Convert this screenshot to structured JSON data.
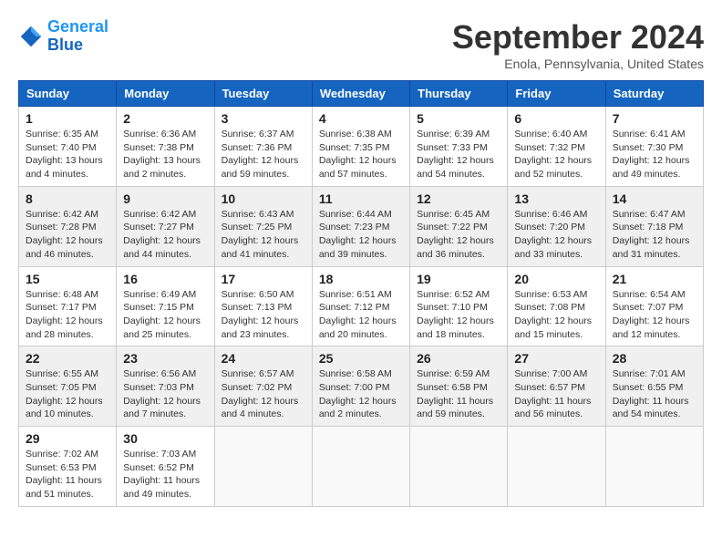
{
  "header": {
    "logo_line1": "General",
    "logo_line2": "Blue",
    "month": "September 2024",
    "location": "Enola, Pennsylvania, United States"
  },
  "weekdays": [
    "Sunday",
    "Monday",
    "Tuesday",
    "Wednesday",
    "Thursday",
    "Friday",
    "Saturday"
  ],
  "weeks": [
    [
      {
        "day": "1",
        "info": "Sunrise: 6:35 AM\nSunset: 7:40 PM\nDaylight: 13 hours\nand 4 minutes."
      },
      {
        "day": "2",
        "info": "Sunrise: 6:36 AM\nSunset: 7:38 PM\nDaylight: 13 hours\nand 2 minutes."
      },
      {
        "day": "3",
        "info": "Sunrise: 6:37 AM\nSunset: 7:36 PM\nDaylight: 12 hours\nand 59 minutes."
      },
      {
        "day": "4",
        "info": "Sunrise: 6:38 AM\nSunset: 7:35 PM\nDaylight: 12 hours\nand 57 minutes."
      },
      {
        "day": "5",
        "info": "Sunrise: 6:39 AM\nSunset: 7:33 PM\nDaylight: 12 hours\nand 54 minutes."
      },
      {
        "day": "6",
        "info": "Sunrise: 6:40 AM\nSunset: 7:32 PM\nDaylight: 12 hours\nand 52 minutes."
      },
      {
        "day": "7",
        "info": "Sunrise: 6:41 AM\nSunset: 7:30 PM\nDaylight: 12 hours\nand 49 minutes."
      }
    ],
    [
      {
        "day": "8",
        "info": "Sunrise: 6:42 AM\nSunset: 7:28 PM\nDaylight: 12 hours\nand 46 minutes."
      },
      {
        "day": "9",
        "info": "Sunrise: 6:42 AM\nSunset: 7:27 PM\nDaylight: 12 hours\nand 44 minutes."
      },
      {
        "day": "10",
        "info": "Sunrise: 6:43 AM\nSunset: 7:25 PM\nDaylight: 12 hours\nand 41 minutes."
      },
      {
        "day": "11",
        "info": "Sunrise: 6:44 AM\nSunset: 7:23 PM\nDaylight: 12 hours\nand 39 minutes."
      },
      {
        "day": "12",
        "info": "Sunrise: 6:45 AM\nSunset: 7:22 PM\nDaylight: 12 hours\nand 36 minutes."
      },
      {
        "day": "13",
        "info": "Sunrise: 6:46 AM\nSunset: 7:20 PM\nDaylight: 12 hours\nand 33 minutes."
      },
      {
        "day": "14",
        "info": "Sunrise: 6:47 AM\nSunset: 7:18 PM\nDaylight: 12 hours\nand 31 minutes."
      }
    ],
    [
      {
        "day": "15",
        "info": "Sunrise: 6:48 AM\nSunset: 7:17 PM\nDaylight: 12 hours\nand 28 minutes."
      },
      {
        "day": "16",
        "info": "Sunrise: 6:49 AM\nSunset: 7:15 PM\nDaylight: 12 hours\nand 25 minutes."
      },
      {
        "day": "17",
        "info": "Sunrise: 6:50 AM\nSunset: 7:13 PM\nDaylight: 12 hours\nand 23 minutes."
      },
      {
        "day": "18",
        "info": "Sunrise: 6:51 AM\nSunset: 7:12 PM\nDaylight: 12 hours\nand 20 minutes."
      },
      {
        "day": "19",
        "info": "Sunrise: 6:52 AM\nSunset: 7:10 PM\nDaylight: 12 hours\nand 18 minutes."
      },
      {
        "day": "20",
        "info": "Sunrise: 6:53 AM\nSunset: 7:08 PM\nDaylight: 12 hours\nand 15 minutes."
      },
      {
        "day": "21",
        "info": "Sunrise: 6:54 AM\nSunset: 7:07 PM\nDaylight: 12 hours\nand 12 minutes."
      }
    ],
    [
      {
        "day": "22",
        "info": "Sunrise: 6:55 AM\nSunset: 7:05 PM\nDaylight: 12 hours\nand 10 minutes."
      },
      {
        "day": "23",
        "info": "Sunrise: 6:56 AM\nSunset: 7:03 PM\nDaylight: 12 hours\nand 7 minutes."
      },
      {
        "day": "24",
        "info": "Sunrise: 6:57 AM\nSunset: 7:02 PM\nDaylight: 12 hours\nand 4 minutes."
      },
      {
        "day": "25",
        "info": "Sunrise: 6:58 AM\nSunset: 7:00 PM\nDaylight: 12 hours\nand 2 minutes."
      },
      {
        "day": "26",
        "info": "Sunrise: 6:59 AM\nSunset: 6:58 PM\nDaylight: 11 hours\nand 59 minutes."
      },
      {
        "day": "27",
        "info": "Sunrise: 7:00 AM\nSunset: 6:57 PM\nDaylight: 11 hours\nand 56 minutes."
      },
      {
        "day": "28",
        "info": "Sunrise: 7:01 AM\nSunset: 6:55 PM\nDaylight: 11 hours\nand 54 minutes."
      }
    ],
    [
      {
        "day": "29",
        "info": "Sunrise: 7:02 AM\nSunset: 6:53 PM\nDaylight: 11 hours\nand 51 minutes."
      },
      {
        "day": "30",
        "info": "Sunrise: 7:03 AM\nSunset: 6:52 PM\nDaylight: 11 hours\nand 49 minutes."
      },
      {
        "day": "",
        "info": ""
      },
      {
        "day": "",
        "info": ""
      },
      {
        "day": "",
        "info": ""
      },
      {
        "day": "",
        "info": ""
      },
      {
        "day": "",
        "info": ""
      }
    ]
  ]
}
